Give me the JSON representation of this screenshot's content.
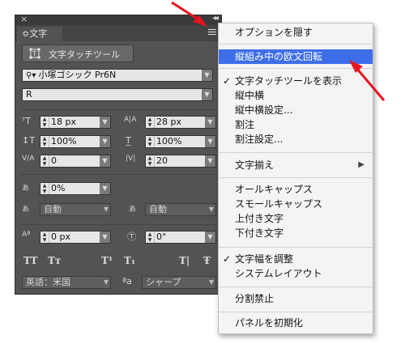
{
  "panel": {
    "close_glyph": "×",
    "collapse_glyph": "◂◂",
    "tab_label": "≎文字",
    "touch_tool_label": "文字タッチツール",
    "font_family": "小塚ゴシック Pr6N",
    "font_style": "R",
    "font_size": "18 px",
    "leading": "28 px",
    "vertical_scale": "100%",
    "horizontal_scale": "100%",
    "kerning": "0",
    "tracking": "20",
    "tsume": "0%",
    "moji_aki_left": "自動",
    "moji_aki_right": "自動",
    "baseline_shift": "0 px",
    "rotation": "0°",
    "format_buttons": [
      "TT",
      "Tт",
      "T¹",
      "T₁",
      "T|",
      "Ŧ"
    ],
    "language": "英語：米国",
    "aa_label": "ªa",
    "antialias": "シャープ",
    "arrow_glyph": "▼"
  },
  "menu": {
    "items": [
      {
        "label": "オプションを隠す",
        "checked": false
      },
      {
        "label": "縦組み中の欧文回転",
        "checked": false,
        "highlighted": true
      },
      {
        "label": "文字タッチツールを表示",
        "checked": true
      },
      {
        "label": "縦中横",
        "checked": false
      },
      {
        "label": "縦中横設定...",
        "checked": false
      },
      {
        "label": "割注",
        "checked": false
      },
      {
        "label": "割注設定...",
        "checked": false
      },
      {
        "label": "文字揃え",
        "checked": false,
        "submenu": true
      },
      {
        "label": "オールキャップス",
        "checked": false
      },
      {
        "label": "スモールキャップス",
        "checked": false
      },
      {
        "label": "上付き文字",
        "checked": false
      },
      {
        "label": "下付き文字",
        "checked": false
      },
      {
        "label": "文字幅を調整",
        "checked": true
      },
      {
        "label": "システムレイアウト",
        "checked": false
      },
      {
        "label": "分割禁止",
        "checked": false
      },
      {
        "label": "パネルを初期化",
        "checked": false
      }
    ],
    "check_glyph": "✓",
    "submenu_glyph": "▶"
  },
  "colors": {
    "panel_bg": "#535353",
    "highlight": "#3d6ee8",
    "annotation_arrow": "#e8141e"
  }
}
